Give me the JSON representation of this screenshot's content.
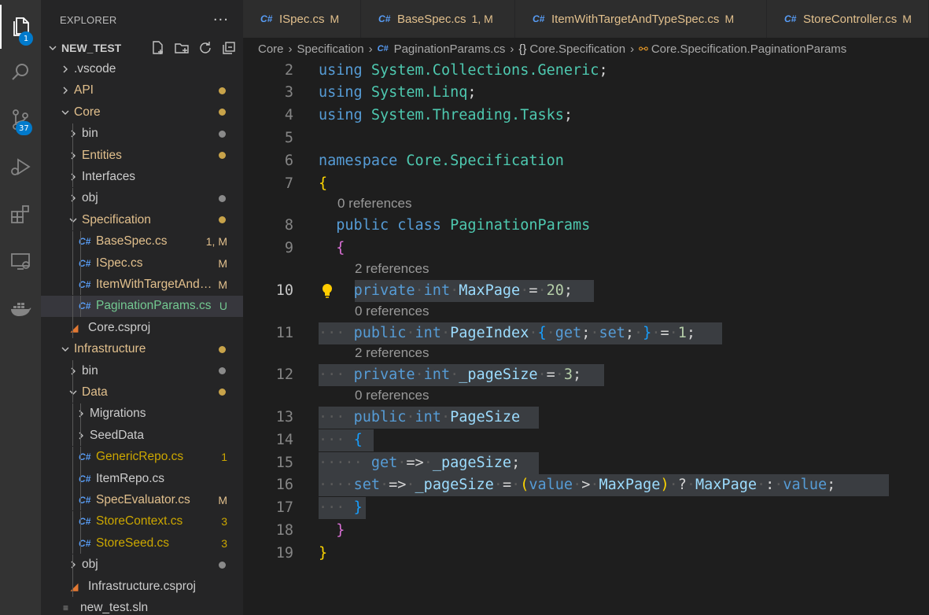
{
  "activity_bar": {
    "explorer_badge": "1",
    "source_control_badge": "37",
    "icons": [
      "explorer-icon",
      "search-icon",
      "source-control-icon",
      "run-debug-icon",
      "extensions-icon",
      "remote-explorer-icon",
      "docker-icon"
    ]
  },
  "sidebar": {
    "title": "EXPLORER",
    "more": "···",
    "root": "NEW_TEST",
    "items": [
      {
        "label": "NEW_TEST",
        "status": "",
        "color": "#cccccc"
      },
      {
        "label": ".vscode",
        "status": "",
        "color": "#cccccc"
      },
      {
        "label": "API",
        "status": "",
        "color": "#e2c08d"
      },
      {
        "label": "Core",
        "status": "",
        "color": "#e2c08d"
      },
      {
        "label": "bin",
        "status": "",
        "color": "#cccccc"
      },
      {
        "label": "Entities",
        "status": "",
        "color": "#e2c08d"
      },
      {
        "label": "Interfaces",
        "status": "",
        "color": "#cccccc"
      },
      {
        "label": "obj",
        "status": "",
        "color": "#cccccc"
      },
      {
        "label": "Specification",
        "status": "",
        "color": "#e2c08d"
      },
      {
        "label": "BaseSpec.cs",
        "status": "1, M",
        "color": "#e2c08d"
      },
      {
        "label": "ISpec.cs",
        "status": "M",
        "color": "#e2c08d"
      },
      {
        "label": "ItemWithTargetAndTypeSpec.cs",
        "status": "M",
        "color": "#e2c08d"
      },
      {
        "label": "PaginationParams.cs",
        "status": "U",
        "color": "#73c991"
      },
      {
        "label": "Core.csproj",
        "status": "",
        "color": "#cccccc"
      },
      {
        "label": "Infrastructure",
        "status": "",
        "color": "#e2c08d"
      },
      {
        "label": "bin",
        "status": "",
        "color": "#cccccc"
      },
      {
        "label": "Data",
        "status": "",
        "color": "#e2c08d"
      },
      {
        "label": "Migrations",
        "status": "",
        "color": "#cccccc"
      },
      {
        "label": "SeedData",
        "status": "",
        "color": "#cccccc"
      },
      {
        "label": "GenericRepo.cs",
        "status": "1",
        "color": "#cca700"
      },
      {
        "label": "ItemRepo.cs",
        "status": "",
        "color": "#cccccc"
      },
      {
        "label": "SpecEvaluator.cs",
        "status": "M",
        "color": "#e2c08d"
      },
      {
        "label": "StoreContext.cs",
        "status": "3",
        "color": "#cca700"
      },
      {
        "label": "StoreSeed.cs",
        "status": "3",
        "color": "#cca700"
      },
      {
        "label": "obj",
        "status": "",
        "color": "#cccccc"
      },
      {
        "label": "Infrastructure.csproj",
        "status": "",
        "color": "#cccccc"
      },
      {
        "label": "new_test.sln",
        "status": "",
        "color": "#cccccc"
      }
    ]
  },
  "tabs": [
    {
      "label": "ISpec.cs",
      "status": "M"
    },
    {
      "label": "BaseSpec.cs",
      "status": "1, M"
    },
    {
      "label": "ItemWithTargetAndTypeSpec.cs",
      "status": "M"
    },
    {
      "label": "StoreController.cs",
      "status": "M"
    }
  ],
  "breadcrumb": [
    "Core",
    "Specification",
    "PaginationParams.cs",
    "Core.Specification",
    "Core.Specification.PaginationParams"
  ],
  "editor": {
    "line_numbers": [
      "2",
      "3",
      "4",
      "5",
      "6",
      "7",
      "8",
      "9",
      "10",
      "11",
      "12",
      "13",
      "14",
      "15",
      "16",
      "17",
      "18",
      "19"
    ],
    "codelens": [
      "0 references",
      "2 references",
      "0 references",
      "2 references",
      "0 references"
    ],
    "lines": {
      "l2": [
        "using",
        "System.Collections.Generic",
        ";"
      ],
      "l3": [
        "using",
        "System.Linq",
        ";"
      ],
      "l4": [
        "using",
        "System.Threading.Tasks",
        ";"
      ],
      "l6": [
        "namespace",
        "Core.Specification"
      ],
      "l7": [
        "{"
      ],
      "l8": [
        "public",
        "class",
        "PaginationParams"
      ],
      "l9": [
        "{"
      ],
      "l10": [
        "private",
        "int",
        "MaxPage",
        "=",
        "20",
        ";"
      ],
      "l11": [
        "public",
        "int",
        "PageIndex",
        "{",
        "get",
        ";",
        "set",
        ";",
        "}",
        "=",
        "1",
        ";"
      ],
      "l12": [
        "private",
        "int",
        "_pageSize",
        "=",
        "3",
        ";"
      ],
      "l13": [
        "public",
        "int",
        "PageSize"
      ],
      "l14": [
        "{"
      ],
      "l15": [
        "get",
        "=>",
        "_pageSize",
        ";"
      ],
      "l16": [
        "set",
        "=>",
        "_pageSize",
        "=",
        "(",
        "value",
        ">",
        "MaxPage",
        ")",
        "?",
        "MaxPage",
        ":",
        "value",
        ";"
      ],
      "l17": [
        "}"
      ],
      "l18": [
        "}"
      ],
      "l19": [
        "}"
      ]
    },
    "ws_dot": "·"
  }
}
